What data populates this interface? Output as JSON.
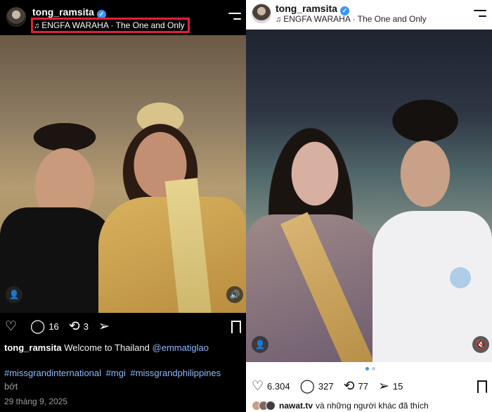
{
  "left_post": {
    "username": "tong_ramsita",
    "music": "ENGFA WARAHA · The One and Only",
    "actions": {
      "comments": "16",
      "reposts": "3"
    },
    "caption_user": "tong_ramsita",
    "caption_text": "Welcome to Thailand",
    "caption_mention": "@emmatiglao",
    "hashtags": [
      "#missgrandinternational",
      "#mgi",
      "#missgrandphilippines"
    ],
    "more_label": "bớt",
    "date": "29 tháng 9, 2025"
  },
  "right_post": {
    "username": "tong_ramsita",
    "music": "ENGFA WARAHA · The One and Only",
    "actions": {
      "likes": "6.304",
      "comments": "327",
      "reposts": "77",
      "shares": "15"
    },
    "liked_by_user": "nawat.tv",
    "liked_by_suffix": "và những người khác đã thích"
  },
  "colors": {
    "highlight_box": "#e0203a",
    "link": "#8fb8ff",
    "verified": "#3897f0"
  }
}
